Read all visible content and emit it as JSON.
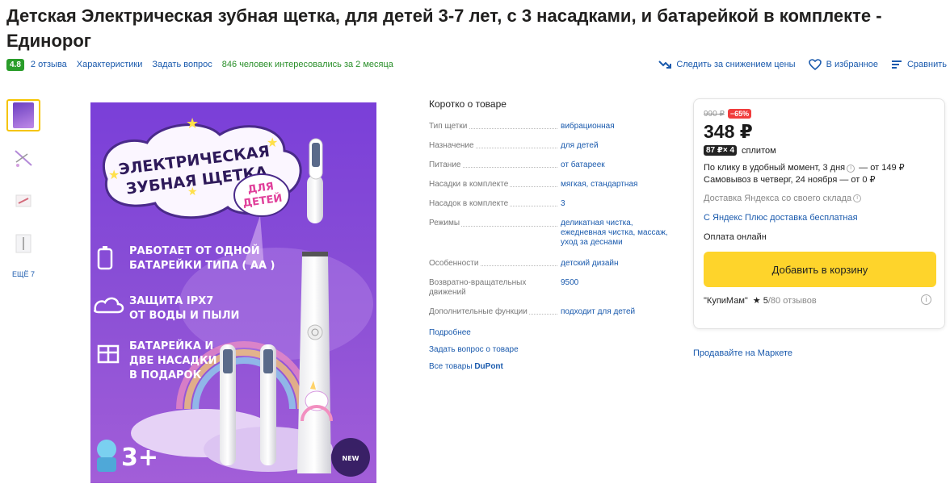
{
  "product": {
    "title": "Детская Электрическая зубная щетка, для детей 3-7 лет, с 3 насадками, и батарейкой в комплекте - Единорог"
  },
  "meta": {
    "rating": "4.8",
    "reviews": "2 отзыва",
    "characteristics": "Характеристики",
    "ask_question": "Задать вопрос",
    "interest": "846 человек интересовались за 2 месяца"
  },
  "actions": {
    "track_price": "Следить за снижением цены",
    "favorite": "В избранное",
    "compare": "Сравнить"
  },
  "gallery": {
    "more": "ЕЩЁ 7",
    "image_texts": {
      "banner_line1": "ЭЛЕКТРИЧЕСКАЯ",
      "banner_line2": "ЗУБНАЯ ЩЕТКА",
      "banner_tag1": "ДЛЯ",
      "banner_tag2": "ДЕТЕЙ",
      "feature1_line1": "РАБОТАЕТ ОТ ОДНОЙ",
      "feature1_line2": "БАТАРЕЙКИ ТИПА ( АА )",
      "feature2_line1": "ЗАЩИТА IPX7",
      "feature2_line2": "ОТ ВОДЫ И ПЫЛИ",
      "feature3_line1": "БАТАРЕЙКА И",
      "feature3_line2": "ДВЕ НАСАДКИ",
      "feature3_line3": "В ПОДАРОК",
      "age": "3+",
      "new_stamp": "NEW"
    }
  },
  "specs": {
    "heading": "Коротко о товаре",
    "rows": [
      {
        "key": "Тип щетки",
        "value": "вибрационная"
      },
      {
        "key": "Назначение",
        "value": "для детей"
      },
      {
        "key": "Питание",
        "value": "от батареек"
      },
      {
        "key": "Насадки в комплекте",
        "value": "мягкая, стандартная"
      },
      {
        "key": "Насадок в комплекте",
        "value": "3"
      },
      {
        "key": "Режимы",
        "value": "деликатная чистка, ежедневная чистка, массаж, уход за деснами"
      },
      {
        "key": "Особенности",
        "value": "детский дизайн"
      },
      {
        "key": "Возвратно-вращательных движений",
        "value": "9500"
      },
      {
        "key": "Дополнительные функции",
        "value": "подходит для детей"
      }
    ],
    "more": "Подробнее",
    "ask": "Задать вопрос о товаре",
    "all_goods_prefix": "Все товары ",
    "brand": "DuPont"
  },
  "offer": {
    "old_price": "990 ₽",
    "discount": "−65%",
    "price": "348 ₽",
    "split_amount": "87 ₽",
    "split_times": "× 4",
    "split_label": "сплитом",
    "delivery_click": "По клику в удобный момент, 3 дня",
    "delivery_click_price": " — от 149 ₽",
    "pickup": "Самовывоз в четверг, 24 ноября — от 0 ₽",
    "yandex_delivery": "Доставка Яндекса со своего склада",
    "plus": "С Яндекс Плюс доставка бесплатная",
    "payment": "Оплата онлайн",
    "cart_button": "Добавить в корзину",
    "seller": "\"КупиМам\"",
    "seller_score": "★ 5",
    "seller_reviews": "/80 отзывов"
  },
  "sell_on_market": "Продавайте на Маркете",
  "colors": {
    "accent_yellow": "#fed42b",
    "link_blue": "#1a5aad",
    "rating_green": "#2a9d2a",
    "discount_red": "#f03d3d",
    "image_purple": "#8a4fd6"
  }
}
